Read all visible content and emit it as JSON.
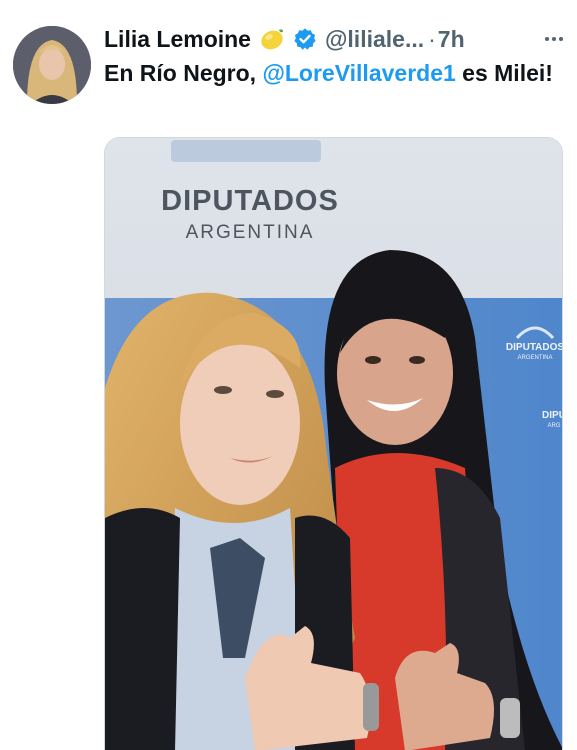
{
  "tweet": {
    "author": {
      "display_name": "Lilia Lemoine",
      "emoji_icon": "lemon-icon",
      "verified_icon": "verified-badge-icon",
      "handle": "@liliale...",
      "separator": "·",
      "time": "7h"
    },
    "more_icon": "more-options-icon",
    "text": {
      "before": "En Río Negro, ",
      "mention": "@LoreVillaverde1",
      "after": " es Milei!"
    },
    "photo": {
      "backdrop_title": "DIPUTADOS",
      "backdrop_subtitle": "ARGENTINA",
      "small_logo_title": "DIPUTADOS",
      "small_logo_subtitle": "ARGENTINA",
      "edge_logo_title": "DIPU",
      "edge_logo_subtitle": "ARG"
    }
  },
  "colors": {
    "text_primary": "#0f1419",
    "text_secondary": "#536471",
    "link": "#1d9bf0",
    "verified": "#1d9bf0",
    "backdrop_blue": "#5a8fd0"
  }
}
